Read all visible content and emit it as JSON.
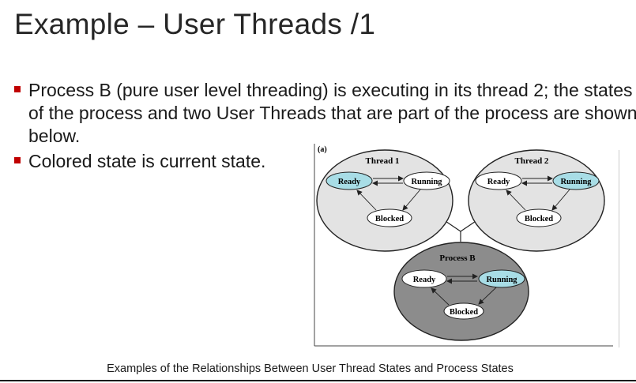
{
  "slide": {
    "title": "Example – User Threads  /1",
    "bullets": [
      "Process B (pure user level threading) is executing in its thread 2; the states of the process and two User Threads that are part of the process are shown below.",
      "Colored state is current state."
    ],
    "caption": "Examples of the Relationships Between User Thread States and Process States"
  },
  "diagram": {
    "panel_label": "(a)",
    "thread1": {
      "title": "Thread 1",
      "ready": "Ready",
      "running": "Running",
      "blocked": "Blocked"
    },
    "thread2": {
      "title": "Thread 2",
      "ready": "Ready",
      "running": "Running",
      "blocked": "Blocked"
    },
    "process": {
      "title": "Process B",
      "ready": "Ready",
      "running": "Running",
      "blocked": "Blocked"
    },
    "colors": {
      "active_state": "#a8dde6",
      "thread_fill": "#e3e3e3",
      "process_fill": "#8c8c8c",
      "bullet": "#c00000"
    }
  }
}
